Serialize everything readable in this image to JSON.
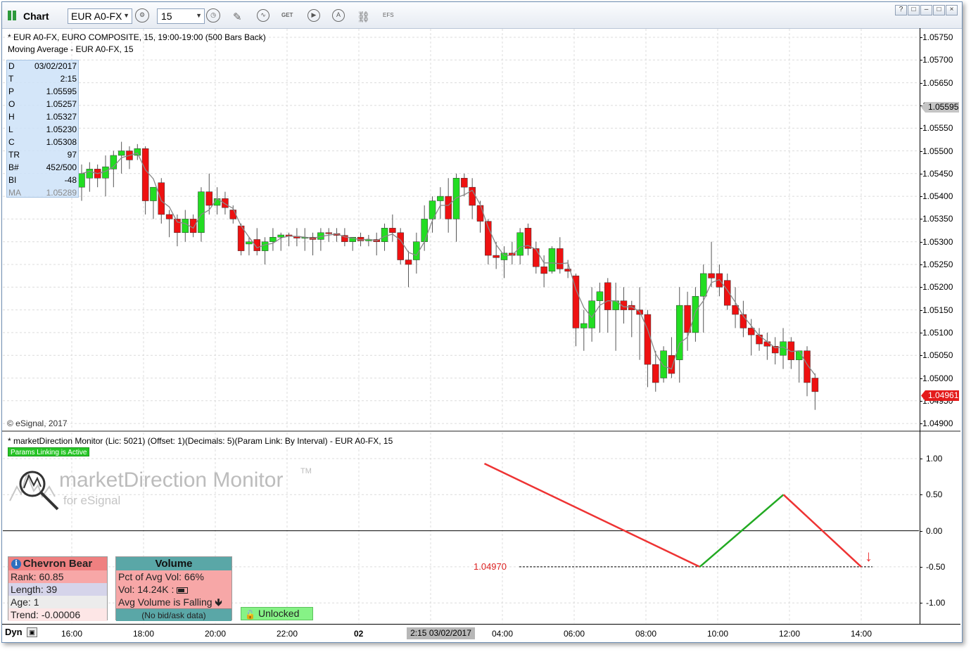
{
  "window": {
    "title": "Chart",
    "symbol": "EUR A0-FX",
    "interval": "15",
    "controls": [
      "?",
      "□",
      "–",
      "□",
      "×"
    ]
  },
  "toolbar": {
    "icons": [
      "gear-icon",
      "clock-icon",
      "pencil-icon",
      "study-icon",
      "get-icon",
      "play-icon",
      "alert-icon",
      "link-icon",
      "efs-icon"
    ],
    "get_label": "GET",
    "alert_label": "A",
    "efs_label": "EFS"
  },
  "price_pane": {
    "header_line1": "* EUR A0-FX, EURO COMPOSITE, 15, 19:00-19:00 (500 Bars Back)",
    "header_line2": "Moving Average - EUR A0-FX, 15",
    "copyright": "© eSignal, 2017",
    "y_labels": [
      "1.05750",
      "1.05700",
      "1.05650",
      "1.05600",
      "1.05550",
      "1.05500",
      "1.05450",
      "1.05400",
      "1.05350",
      "1.05300",
      "1.05250",
      "1.05200",
      "1.05150",
      "1.05100",
      "1.05050",
      "1.05000",
      "1.04950",
      "1.04900"
    ],
    "last_price_tag": "1.05595",
    "current_price_tag": "1.04961",
    "hidden_label": "1.04960"
  },
  "data_window": {
    "rows": [
      {
        "k": "D",
        "v": "03/02/2017"
      },
      {
        "k": "T",
        "v": "2:15"
      },
      {
        "k": "P",
        "v": "1.05595"
      },
      {
        "k": "O",
        "v": "1.05257"
      },
      {
        "k": "H",
        "v": "1.05327"
      },
      {
        "k": "L",
        "v": "1.05230"
      },
      {
        "k": "C",
        "v": "1.05308"
      },
      {
        "k": "TR",
        "v": "97"
      },
      {
        "k": "B#",
        "v": "452/500"
      },
      {
        "k": "BI",
        "v": "-48"
      },
      {
        "k": "MA",
        "v": "1.05289"
      }
    ]
  },
  "indicator_pane": {
    "header": "* marketDirection Monitor (Lic: 5021) (Offset: 1)(Decimals: 5)(Param Link: By Interval) - EUR A0-FX, 15",
    "params_badge": "Params Linking is Active",
    "logo_title": "marketDirection Monitor",
    "logo_tm": "TM",
    "logo_sub": "for eSignal",
    "y_labels": [
      "1.00",
      "0.50",
      "0.00",
      "-0.50",
      "-1.00"
    ],
    "level_label": "1.04970",
    "arrow": "↓"
  },
  "chevron_panel": {
    "title": "Chevron Bear",
    "icon": "i",
    "rank": "Rank: 60.85",
    "length": "Length: 39",
    "age": "Age: 1",
    "trend": "Trend: -0.00006"
  },
  "volume_panel": {
    "title": "Volume",
    "pct": "Pct of Avg Vol: 66%",
    "vol": "Vol: 14.24K :",
    "status": "Avg Volume is Falling",
    "footer": "(No bid/ask data)"
  },
  "lock_button": {
    "label": "Unlocked"
  },
  "time_axis": {
    "mode": "Dyn",
    "labels": [
      "16:00",
      "18:00",
      "20:00",
      "22:00",
      "02",
      "04:00",
      "06:00",
      "08:00",
      "10:00",
      "12:00",
      "14:00"
    ],
    "cursor_label": "2:15 03/02/2017"
  },
  "colors": {
    "up": "#22dd22",
    "down": "#ee1111",
    "ma": "#888888",
    "signal_red": "#ee3333",
    "signal_green": "#22aa22"
  },
  "chart_data": {
    "type": "candlestick",
    "ohlc": [
      [
        1.0542,
        1.0547,
        1.0539,
        1.0545
      ],
      [
        1.0544,
        1.05475,
        1.0541,
        1.0546
      ],
      [
        1.0546,
        1.0547,
        1.0542,
        1.0544
      ],
      [
        1.0544,
        1.0549,
        1.054,
        1.05465
      ],
      [
        1.0546,
        1.055,
        1.0542,
        1.0549
      ],
      [
        1.0549,
        1.0552,
        1.0545,
        1.055
      ],
      [
        1.055,
        1.0551,
        1.0546,
        1.0548
      ],
      [
        1.0549,
        1.05515,
        1.0548,
        1.05505
      ],
      [
        1.05505,
        1.0551,
        1.0536,
        1.0539
      ],
      [
        1.0539,
        1.0542,
        1.0535,
        1.0542
      ],
      [
        1.0543,
        1.0544,
        1.0534,
        1.0536
      ],
      [
        1.0536,
        1.0537,
        1.0531,
        1.0535
      ],
      [
        1.0535,
        1.0536,
        1.0529,
        1.0532
      ],
      [
        1.0532,
        1.0537,
        1.053,
        1.0535
      ],
      [
        1.0535,
        1.0536,
        1.0531,
        1.0532
      ],
      [
        1.0532,
        1.0542,
        1.053,
        1.0541
      ],
      [
        1.0541,
        1.0545,
        1.0536,
        1.0538
      ],
      [
        1.0538,
        1.0542,
        1.0536,
        1.05395
      ],
      [
        1.05395,
        1.0541,
        1.0536,
        1.05375
      ],
      [
        1.0537,
        1.0538,
        1.0534,
        1.0535
      ],
      [
        1.05335,
        1.0534,
        1.0527,
        1.0528
      ],
      [
        1.05295,
        1.0531,
        1.0527,
        1.053
      ],
      [
        1.05305,
        1.0533,
        1.0527,
        1.0528
      ],
      [
        1.0528,
        1.0531,
        1.0525,
        1.053
      ],
      [
        1.053,
        1.0533,
        1.0528,
        1.0531
      ],
      [
        1.0531,
        1.0532,
        1.0528,
        1.05315
      ],
      [
        1.05315,
        1.0532,
        1.0529,
        1.05312
      ],
      [
        1.05312,
        1.0533,
        1.0529,
        1.05308
      ],
      [
        1.05308,
        1.0533,
        1.0528,
        1.0531
      ],
      [
        1.0531,
        1.0532,
        1.0527,
        1.05305
      ],
      [
        1.05305,
        1.0533,
        1.0528,
        1.0532
      ],
      [
        1.0532,
        1.0533,
        1.053,
        1.05318
      ],
      [
        1.05318,
        1.0533,
        1.053,
        1.05314
      ],
      [
        1.05314,
        1.0533,
        1.0529,
        1.053
      ],
      [
        1.053,
        1.0531,
        1.0528,
        1.0531
      ],
      [
        1.0531,
        1.0532,
        1.0529,
        1.05302
      ],
      [
        1.05302,
        1.05315,
        1.0529,
        1.05305
      ],
      [
        1.05305,
        1.0532,
        1.0527,
        1.053
      ],
      [
        1.053,
        1.0534,
        1.0528,
        1.0533
      ],
      [
        1.0533,
        1.0536,
        1.053,
        1.0532
      ],
      [
        1.0532,
        1.0533,
        1.0525,
        1.0526
      ],
      [
        1.0526,
        1.0528,
        1.052,
        1.0525
      ],
      [
        1.0526,
        1.0532,
        1.0523,
        1.053
      ],
      [
        1.053,
        1.0538,
        1.0528,
        1.0535
      ],
      [
        1.0535,
        1.054,
        1.0532,
        1.0539
      ],
      [
        1.0539,
        1.0542,
        1.0535,
        1.054
      ],
      [
        1.054,
        1.0544,
        1.0532,
        1.0535
      ],
      [
        1.0535,
        1.0545,
        1.053,
        1.0544
      ],
      [
        1.0544,
        1.0545,
        1.054,
        1.0542
      ],
      [
        1.0542,
        1.0544,
        1.0535,
        1.0538
      ],
      [
        1.0538,
        1.0539,
        1.0532,
        1.05345
      ],
      [
        1.05345,
        1.0535,
        1.0525,
        1.0527
      ],
      [
        1.0527,
        1.053,
        1.0524,
        1.05265
      ],
      [
        1.0526,
        1.0529,
        1.0522,
        1.05275
      ],
      [
        1.05275,
        1.053,
        1.0525,
        1.0527
      ],
      [
        1.0527,
        1.0533,
        1.0525,
        1.0532
      ],
      [
        1.0533,
        1.0534,
        1.0527,
        1.05285
      ],
      [
        1.05285,
        1.053,
        1.0523,
        1.05245
      ],
      [
        1.05245,
        1.0527,
        1.052,
        1.0523
      ],
      [
        1.05235,
        1.0529,
        1.0523,
        1.05285
      ],
      [
        1.05285,
        1.0531,
        1.0523,
        1.0524
      ],
      [
        1.0524,
        1.0526,
        1.0522,
        1.05235
      ],
      [
        1.05225,
        1.0523,
        1.0507,
        1.0511
      ],
      [
        1.0511,
        1.0515,
        1.0506,
        1.0512
      ],
      [
        1.0511,
        1.052,
        1.0508,
        1.0517
      ],
      [
        1.0517,
        1.0521,
        1.051,
        1.0519
      ],
      [
        1.0521,
        1.0522,
        1.051,
        1.0515
      ],
      [
        1.0515,
        1.0521,
        1.0506,
        1.0517
      ],
      [
        1.0517,
        1.052,
        1.0512,
        1.0515
      ],
      [
        1.0516,
        1.0517,
        1.0509,
        1.0515
      ],
      [
        1.0515,
        1.052,
        1.0504,
        1.0514
      ],
      [
        1.0514,
        1.0515,
        1.0498,
        1.0503
      ],
      [
        1.0503,
        1.0506,
        1.0497,
        1.0499
      ],
      [
        1.05,
        1.0507,
        1.0499,
        1.0506
      ],
      [
        1.0505,
        1.0509,
        1.05,
        1.0501
      ],
      [
        1.0504,
        1.052,
        1.0499,
        1.0516
      ],
      [
        1.0516,
        1.0519,
        1.0506,
        1.051
      ],
      [
        1.051,
        1.052,
        1.0508,
        1.0518
      ],
      [
        1.0518,
        1.0525,
        1.051,
        1.0523
      ],
      [
        1.0523,
        1.053,
        1.052,
        1.0522
      ],
      [
        1.0523,
        1.0525,
        1.0518,
        1.052
      ],
      [
        1.05215,
        1.0523,
        1.0515,
        1.0516
      ],
      [
        1.0516,
        1.052,
        1.0511,
        1.0514
      ],
      [
        1.0514,
        1.0517,
        1.0509,
        1.0511
      ],
      [
        1.0511,
        1.0513,
        1.0505,
        1.05095
      ],
      [
        1.05095,
        1.0511,
        1.0506,
        1.05075
      ],
      [
        1.0508,
        1.051,
        1.0504,
        1.0507
      ],
      [
        1.0507,
        1.0509,
        1.0503,
        1.05055
      ],
      [
        1.0505,
        1.0511,
        1.0502,
        1.0508
      ],
      [
        1.0508,
        1.0509,
        1.0502,
        1.0504
      ],
      [
        1.0504,
        1.0506,
        1.0499,
        1.0506
      ],
      [
        1.0506,
        1.0507,
        1.0496,
        1.0499
      ],
      [
        1.05,
        1.0501,
        1.0493,
        1.0497
      ]
    ],
    "signal": {
      "x": [
        "03:30",
        "09:30",
        "11:50",
        "14:00"
      ],
      "y": [
        0.93,
        -0.5,
        0.5,
        -0.5
      ]
    }
  }
}
